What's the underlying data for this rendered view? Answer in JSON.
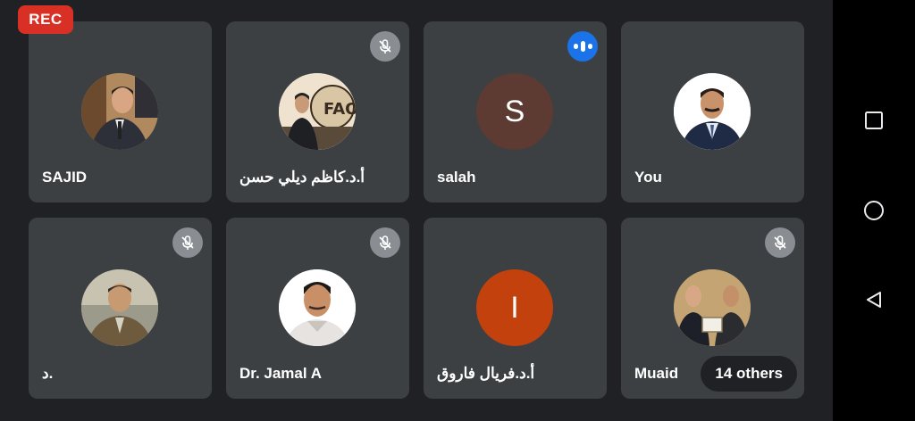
{
  "recording_badge": "REC",
  "participants": [
    {
      "name": "SAJID",
      "mic": "on",
      "avatar": "photo"
    },
    {
      "name": "أ.د.كاظم ديلي حسن",
      "mic": "muted",
      "avatar": "photo"
    },
    {
      "name": "salah",
      "mic": "speaking",
      "avatar": "initial",
      "initial": "S",
      "color": "#5d3a32"
    },
    {
      "name": "You",
      "mic": "on",
      "avatar": "photo"
    },
    {
      "name": "د.",
      "mic": "muted",
      "avatar": "photo"
    },
    {
      "name": "Dr. Jamal A",
      "mic": "muted",
      "avatar": "photo"
    },
    {
      "name": "أ.د.فريال فاروق",
      "mic": "on",
      "avatar": "initial",
      "initial": "I",
      "color": "#c2410c"
    },
    {
      "name": "Muaid",
      "mic": "muted",
      "avatar": "photo"
    }
  ],
  "others_label": "14 others",
  "icons": {
    "muted": "mic-off-icon",
    "speaking": "audio-level-icon",
    "nav": [
      "recents-square-icon",
      "home-circle-icon",
      "back-triangle-icon"
    ]
  },
  "colors": {
    "background": "#202124",
    "tile": "#3c4043",
    "rec": "#d93025",
    "speaking": "#1a73e8"
  }
}
